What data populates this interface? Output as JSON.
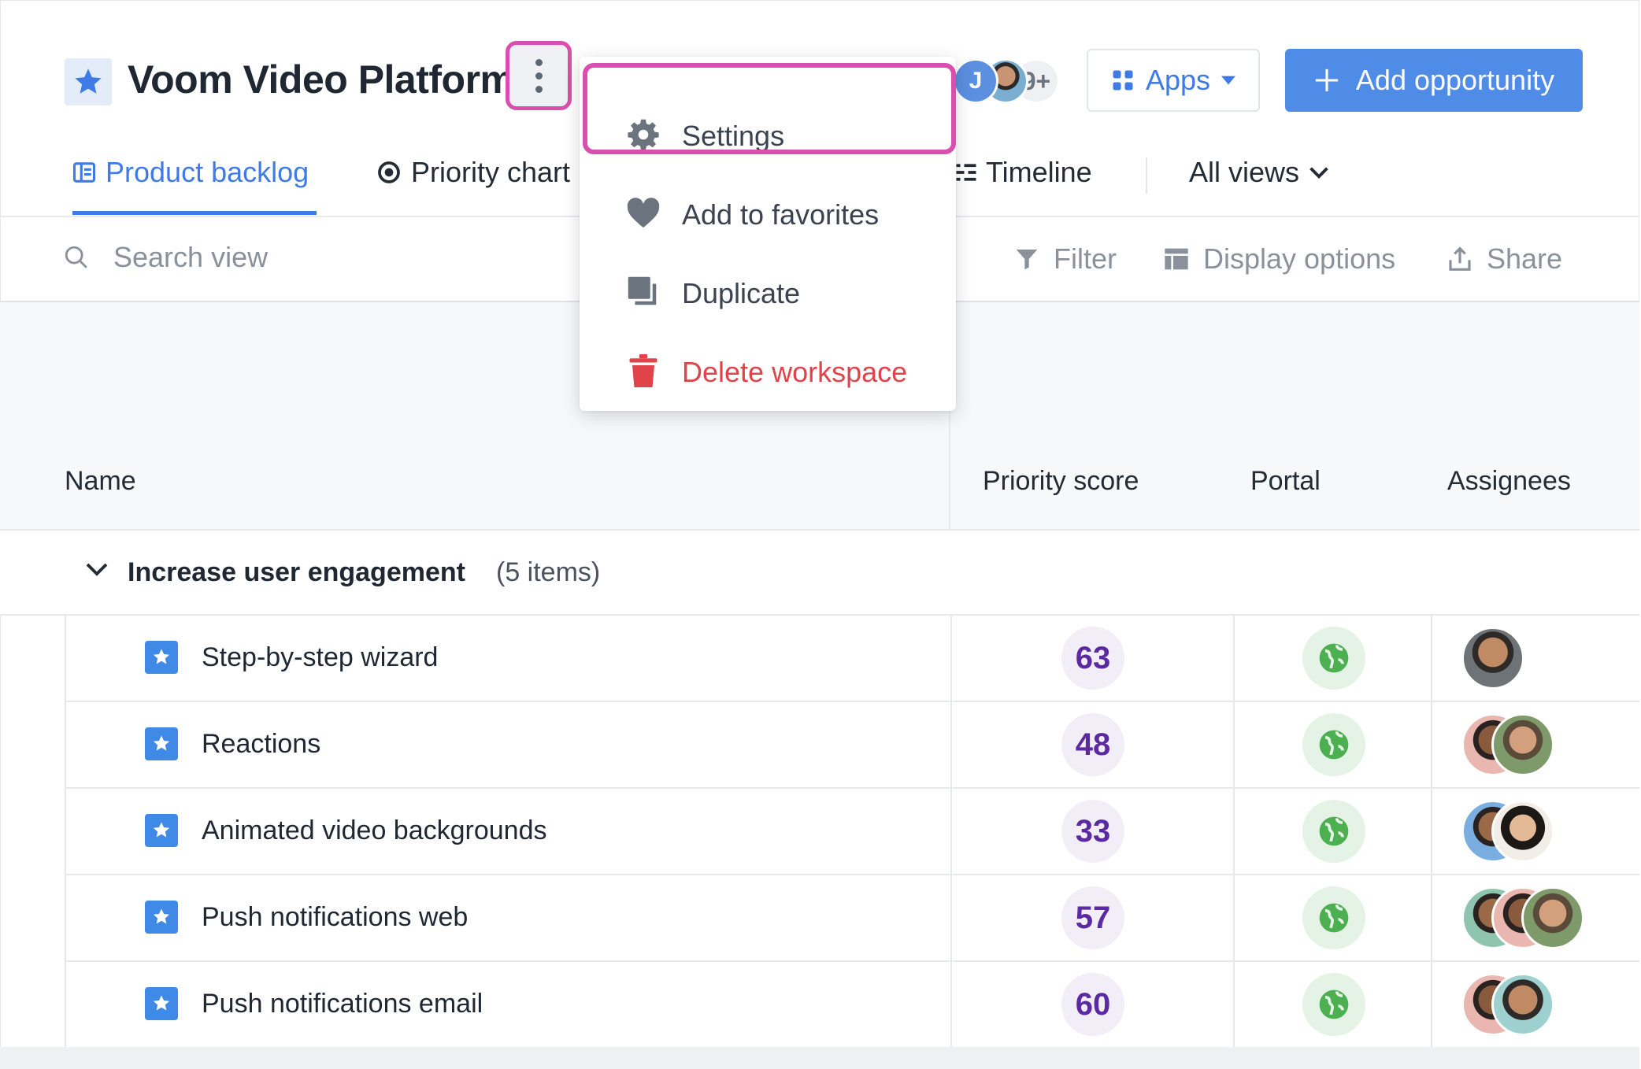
{
  "workspace": {
    "title": "Voom Video Platform",
    "icon": "star-icon",
    "more_icon": "kebab-icon"
  },
  "header": {
    "avatar_initial": "J",
    "avatar_more": "9+",
    "apps_label": "Apps",
    "add_label": "Add opportunity"
  },
  "tabs": [
    {
      "label": "Product backlog",
      "icon": "board-icon",
      "active": true
    },
    {
      "label": "Priority chart",
      "icon": "target-icon",
      "active": false
    },
    {
      "label": "Timeline",
      "icon": "timeline-icon",
      "active": false
    },
    {
      "label": "All views",
      "icon": "chevron-down-icon",
      "active": false
    }
  ],
  "toolbar": {
    "search_placeholder": "Search view",
    "filter": "Filter",
    "display": "Display options",
    "share": "Share"
  },
  "columns": {
    "name": "Name",
    "priority": "Priority score",
    "portal": "Portal",
    "assignees": "Assignees"
  },
  "group": {
    "title": "Increase user engagement",
    "count": "(5 items)"
  },
  "rows": [
    {
      "name": "Step-by-step wizard",
      "score": "63",
      "assignees": 1
    },
    {
      "name": "Reactions",
      "score": "48",
      "assignees": 2
    },
    {
      "name": "Animated video backgrounds",
      "score": "33",
      "assignees": 2
    },
    {
      "name": "Push notifications web",
      "score": "57",
      "assignees": 3
    },
    {
      "name": "Push notifications email",
      "score": "60",
      "assignees": 2
    }
  ],
  "menu": {
    "items": [
      {
        "label": "Settings",
        "icon": "gear-icon",
        "highlighted": true
      },
      {
        "label": "Add to favorites",
        "icon": "heart-icon"
      },
      {
        "label": "Duplicate",
        "icon": "duplicate-icon"
      },
      {
        "label": "Delete workspace",
        "icon": "trash-icon",
        "danger": true
      }
    ]
  },
  "colors": {
    "accent": "#3f7be6",
    "highlight": "#d94fae",
    "danger": "#e0444a",
    "score_text": "#5b2aa0",
    "portal_green": "#4caf50"
  }
}
